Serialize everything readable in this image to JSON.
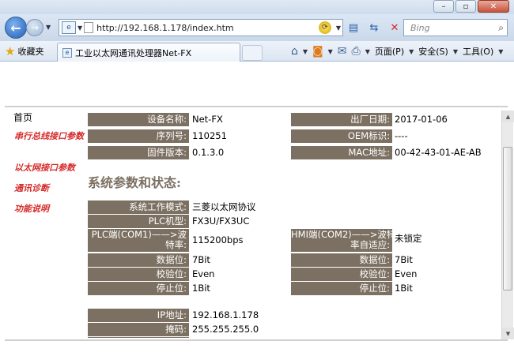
{
  "browser": {
    "url": "http://192.168.1.178/index.htm",
    "search_placeholder": "Bing",
    "favorites_label": "收藏夹",
    "tab_title": "工业以太网通讯处理器Net-FX",
    "menu": {
      "page": "页面(P)",
      "safety": "安全(S)",
      "tools": "工具(O)"
    },
    "icons": [
      "back-arrow-icon",
      "forward-arrow-icon",
      "refresh-icon",
      "stop-icon",
      "search-icon",
      "star-icon",
      "home-icon",
      "rss-icon",
      "mail-icon",
      "print-icon"
    ]
  },
  "sidebar": {
    "home": "首页",
    "items": [
      "串行总线接口参数",
      "以太网接口参数",
      "通讯诊断",
      "功能说明"
    ]
  },
  "device": {
    "name_label": "设备名称:",
    "name": "Net-FX",
    "date_label": "出厂日期:",
    "date": "2017-01-06",
    "serial_label": "序列号:",
    "serial": "110251",
    "oem_label": "OEM标识:",
    "oem": "----",
    "firmware_label": "固件版本:",
    "firmware": "0.1.3.0",
    "mac_label": "MAC地址:",
    "mac": "00-42-43-01-AE-AB"
  },
  "status": {
    "title": "系统参数和状态:",
    "mode_label": "系统工作模式:",
    "mode": "三菱以太网协议",
    "plc_label": "PLC机型:",
    "plc": "FX3U/FX3UC",
    "com1_label_line1": "PLC端(COM1)——>波",
    "com1_label_line2": "特率:",
    "com1_baud": "115200bps",
    "com2_label_line1": "HMI端(COM2)——>波特",
    "com2_label_line2": "率自适应:",
    "com2_baud": "未锁定",
    "databits_label": "数据位:",
    "databits1": "7Bit",
    "databits2": "7Bit",
    "parity_label": "校验位:",
    "parity1": "Even",
    "parity2": "Even",
    "stopbits_label": "停止位:",
    "stopbits1": "1Bit",
    "stopbits2": "1Bit",
    "ip_label": "IP地址:",
    "ip": "192.168.1.178",
    "mask_label": "掩码:",
    "mask": "255.255.255.0"
  },
  "colors": {
    "label_bg": "#7c7062",
    "link_red": "#d62a2a",
    "chrome_blue": "#c9d8ea"
  }
}
